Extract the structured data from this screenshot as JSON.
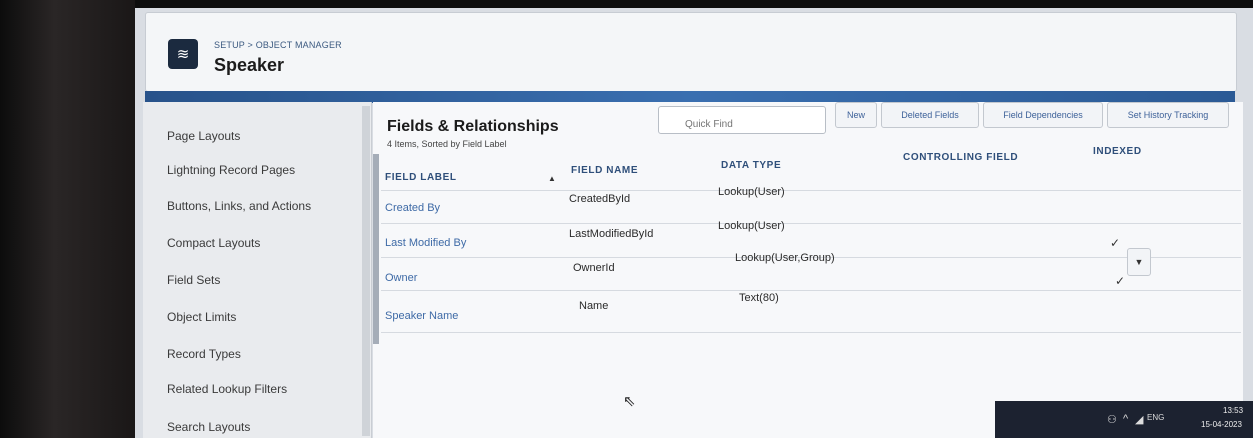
{
  "header": {
    "breadcrumb": "SETUP > OBJECT MANAGER",
    "title": "Speaker",
    "icon": "stack-icon"
  },
  "sidebar": {
    "items": [
      {
        "label": "Page Layouts"
      },
      {
        "label": "Lightning Record Pages"
      },
      {
        "label": "Buttons, Links, and Actions"
      },
      {
        "label": "Compact Layouts"
      },
      {
        "label": "Field Sets"
      },
      {
        "label": "Object Limits"
      },
      {
        "label": "Record Types"
      },
      {
        "label": "Related Lookup Filters"
      },
      {
        "label": "Search Layouts"
      }
    ]
  },
  "main": {
    "title": "Fields & Relationships",
    "subtitle": "4 Items, Sorted by Field Label",
    "search_placeholder": "Quick Find",
    "buttons": {
      "new": "New",
      "deleted_fields": "Deleted Fields",
      "field_dependencies": "Field Dependencies",
      "set_history_tracking": "Set History Tracking"
    },
    "columns": {
      "field_label": "FIELD LABEL",
      "field_name": "FIELD NAME",
      "data_type": "DATA TYPE",
      "controlling_field": "CONTROLLING FIELD",
      "indexed": "INDEXED"
    },
    "rows": [
      {
        "label": "Created By",
        "name": "CreatedById",
        "type": "Lookup(User)",
        "controlling": "",
        "indexed": false
      },
      {
        "label": "Last Modified By",
        "name": "LastModifiedById",
        "type": "Lookup(User)",
        "controlling": "",
        "indexed": true
      },
      {
        "label": "Owner",
        "name": "OwnerId",
        "type": "Lookup(User,Group)",
        "controlling": "",
        "indexed": true
      },
      {
        "label": "Speaker Name",
        "name": "Name",
        "type": "Text(80)",
        "controlling": "",
        "indexed": false
      }
    ],
    "check_glyph": "✓"
  },
  "taskbar": {
    "language": "ENG",
    "time": "13:53",
    "date": "15-04-2023"
  },
  "colors": {
    "link": "#3e6aa6",
    "header_band": "#2b5a95",
    "icon_bg": "#1b2a3f"
  }
}
